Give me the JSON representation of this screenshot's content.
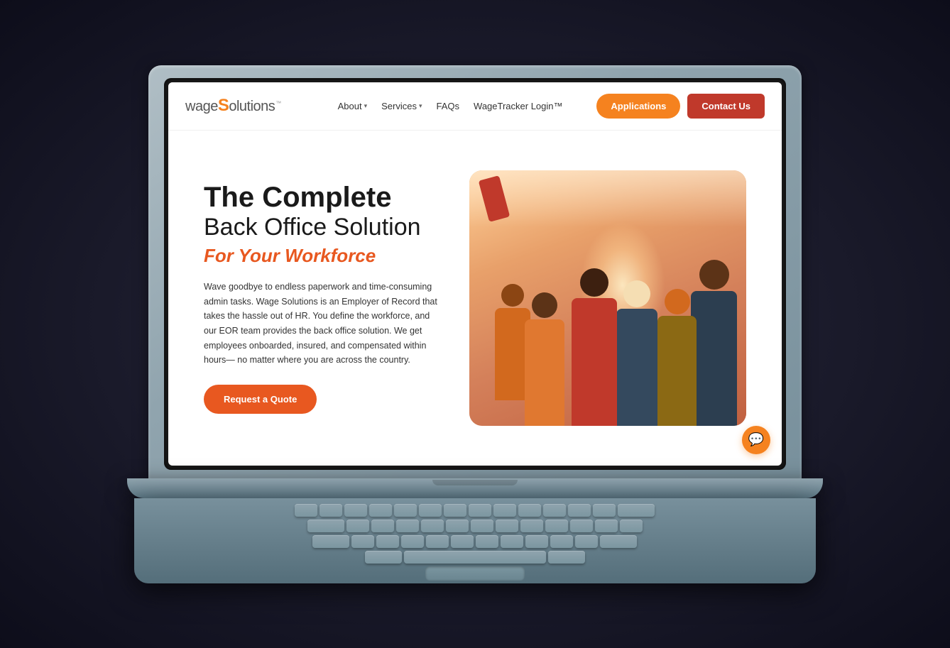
{
  "laptop": {
    "keyboard_rows": [
      [
        "",
        "",
        "",
        "",
        "",
        "",
        "",
        "",
        "",
        "",
        "",
        "",
        "",
        "wide"
      ],
      [
        "wide",
        "",
        "",
        "",
        "",
        "",
        "",
        "",
        "",
        "",
        "",
        "",
        ""
      ],
      [
        "wide",
        "",
        "",
        "",
        "",
        "",
        "",
        "",
        "",
        "",
        "",
        "wide"
      ],
      [
        "wide",
        "space",
        "wide"
      ]
    ]
  },
  "header": {
    "logo": {
      "prefix": "wage",
      "highlight": "S",
      "suffix": "olutions",
      "trademark": "™"
    },
    "nav": [
      {
        "label": "About",
        "has_dropdown": true
      },
      {
        "label": "Services",
        "has_dropdown": true
      },
      {
        "label": "FAQs",
        "has_dropdown": false
      },
      {
        "label": "WageTracker Login™",
        "has_dropdown": false
      }
    ],
    "applications_label": "Applications",
    "contact_label": "Contact Us"
  },
  "hero": {
    "title_bold": "The Complete",
    "title_regular": "Back Office Solution",
    "subtitle": "For Your Workforce",
    "body": "Wave goodbye to endless paperwork and time-consuming admin tasks. Wage Solutions is an Employer of Record that takes the hassle out of HR. You define the workforce, and our EOR team provides the back office solution. We get employees onboarded, insured, and compensated within hours— no matter where you are across the country.",
    "cta_label": "Request a Quote"
  },
  "chat": {
    "icon": "💬"
  },
  "colors": {
    "orange": "#f5821f",
    "red": "#e85820",
    "dark_red": "#c0392b"
  }
}
